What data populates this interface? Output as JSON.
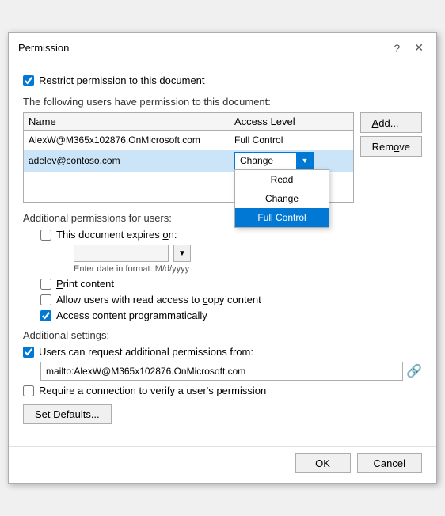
{
  "dialog": {
    "title": "Permission",
    "help_btn": "?",
    "close_btn": "✕"
  },
  "restrict_checkbox": {
    "label": "Restrict permission to this document",
    "checked": true
  },
  "users_label": "The following users have permission to this document:",
  "table": {
    "headers": [
      "Name",
      "Access Level"
    ],
    "rows": [
      {
        "name": "AlexW@M365x102876.OnMicrosoft.com",
        "access": "Full Control",
        "selected": false,
        "dropdown": false
      },
      {
        "name": "adelev@contoso.com",
        "access": "Change",
        "selected": true,
        "dropdown": true
      }
    ],
    "dropdown_options": [
      "Read",
      "Change",
      "Full Control"
    ],
    "dropdown_active": "Full Control"
  },
  "side_buttons": {
    "add": "Add...",
    "remove": "Remove"
  },
  "additional_permissions_label": "Additional permissions for users:",
  "expires_checkbox": {
    "label": "This document expires on:",
    "checked": false
  },
  "date_placeholder": "Enter date in format: M/d/yyyy",
  "print_checkbox": {
    "label": "Print content",
    "checked": false
  },
  "copy_checkbox": {
    "label": "Allow users with read access to copy content",
    "checked": false
  },
  "programmatic_checkbox": {
    "label": "Access content programmatically",
    "checked": true
  },
  "additional_settings_label": "Additional settings:",
  "request_permissions_checkbox": {
    "label": "Users can request additional permissions from:",
    "checked": true
  },
  "email_value": "mailto:AlexW@M365x102876.OnMicrosoft.com",
  "connection_checkbox": {
    "label": "Require a connection to verify a user's permission",
    "checked": false
  },
  "set_defaults_btn": "Set Defaults...",
  "footer": {
    "ok": "OK",
    "cancel": "Cancel"
  }
}
